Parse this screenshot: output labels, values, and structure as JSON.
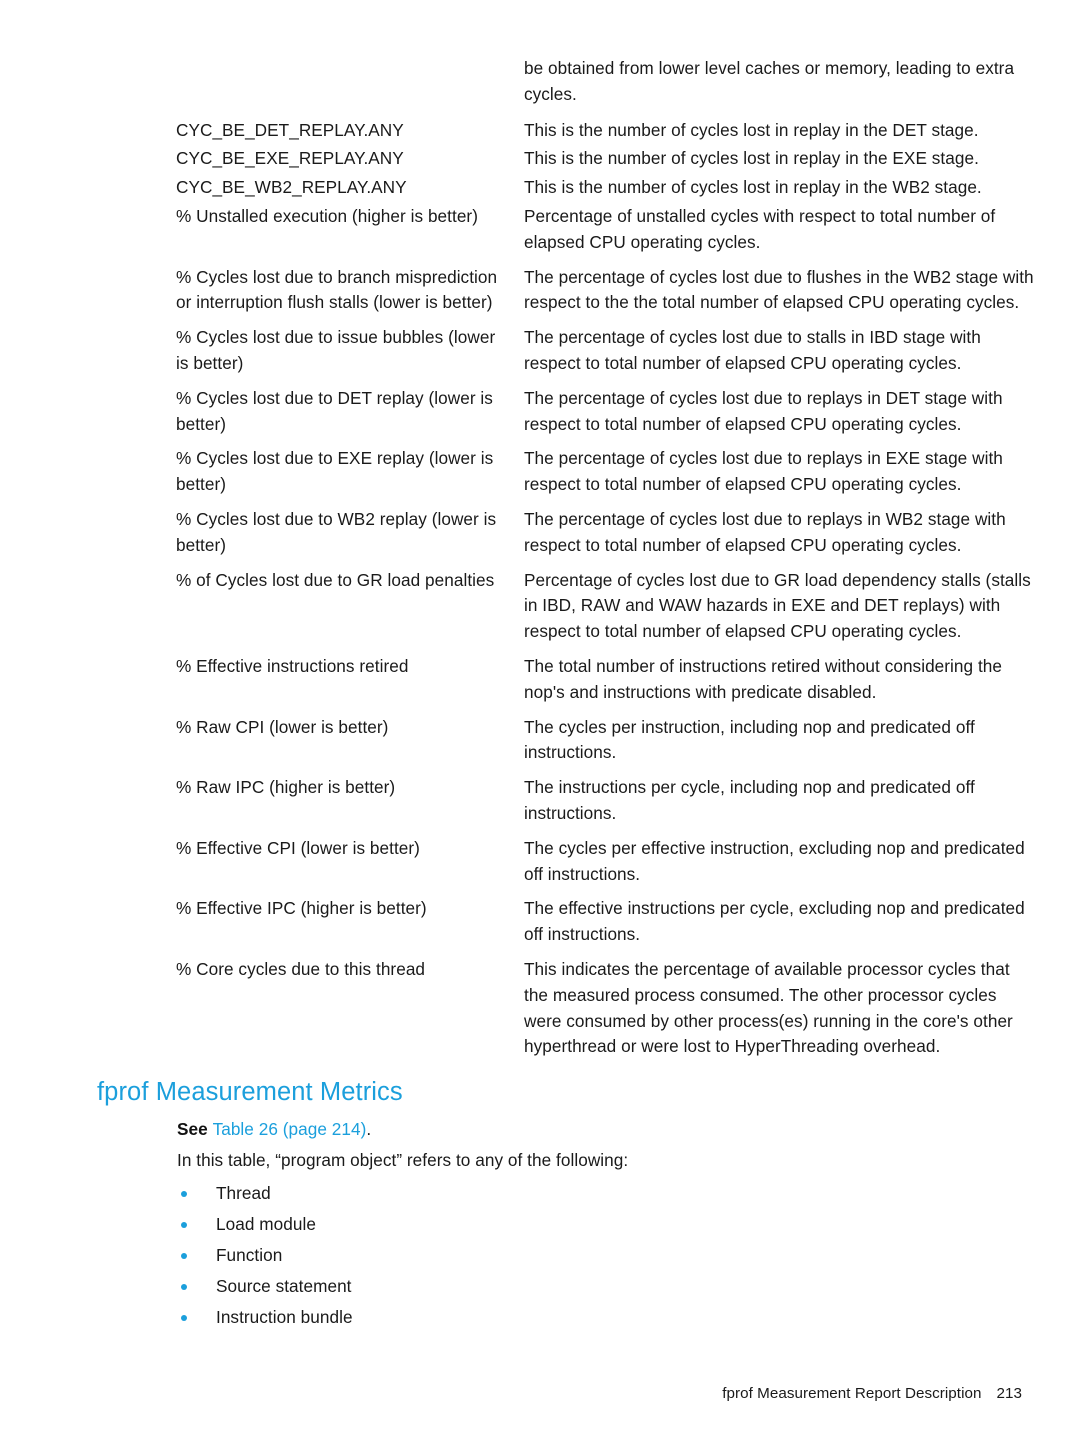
{
  "document": {
    "table_continuation": {
      "rows": [
        {
          "term": "",
          "description": "be obtained from lower level caches or memory, leading to extra cycles.",
          "continuation": true
        },
        {
          "term": "CYC_BE_DET_REPLAY.ANY",
          "description": "This is the number of cycles lost in replay in the DET stage.",
          "tight": true
        },
        {
          "term": "CYC_BE_EXE_REPLAY.ANY",
          "description": "This is the number of cycles lost in replay in the EXE stage.",
          "tight": true
        },
        {
          "term": "CYC_BE_WB2_REPLAY.ANY",
          "description": "This is the number of cycles lost in replay in the WB2 stage.",
          "tight": true
        },
        {
          "term": "% Unstalled execution (higher is better)",
          "description": "Percentage of unstalled cycles with respect to total number of elapsed CPU operating cycles."
        },
        {
          "term": "% Cycles lost due to branch misprediction or interruption flush stalls (lower is better)",
          "description": "The percentage of cycles lost due to flushes in the WB2 stage with respect to the the total number of elapsed CPU operating cycles."
        },
        {
          "term": "% Cycles lost due to issue bubbles (lower is better)",
          "description": "The percentage of cycles lost due to stalls in IBD stage with respect to total number of elapsed CPU operating cycles."
        },
        {
          "term": "% Cycles lost due to DET replay (lower is better)",
          "description": "The percentage of cycles lost due to replays in DET stage with respect to total number of elapsed CPU operating cycles."
        },
        {
          "term": "% Cycles lost due to EXE replay (lower is better)",
          "description": "The percentage of cycles lost due to replays in EXE stage with respect to total number of elapsed CPU operating cycles."
        },
        {
          "term": "% Cycles lost due to WB2 replay (lower is better)",
          "description": "The percentage of cycles lost due to replays in WB2 stage with respect to total number of elapsed CPU operating cycles."
        },
        {
          "term": "% of Cycles lost due to GR load penalties",
          "description": "Percentage of cycles lost due to GR load dependency stalls (stalls in IBD, RAW and WAW hazards in EXE and DET replays) with respect to total number of elapsed CPU operating cycles."
        },
        {
          "term": "% Effective instructions retired",
          "description": "The total number of instructions retired without considering the nop's and instructions with predicate disabled."
        },
        {
          "term": "% Raw CPI (lower is better)",
          "description": "The cycles per instruction, including nop and predicated off instructions."
        },
        {
          "term": "% Raw IPC (higher is better)",
          "description": "The instructions per cycle, including nop and predicated off instructions."
        },
        {
          "term": "% Effective CPI (lower is better)",
          "description": "The cycles per effective instruction, excluding nop and predicated off instructions."
        },
        {
          "term": "% Effective IPC (higher is better)",
          "description": "The effective instructions per cycle, excluding nop and predicated off instructions."
        },
        {
          "term": "% Core cycles due to this thread",
          "description": "This indicates the percentage of available processor cycles that the measured process consumed. The other processor cycles were consumed by other process(es) running in the core's other hyperthread or were lost to HyperThreading overhead."
        }
      ]
    },
    "section": {
      "heading": "fprof Measurement Metrics",
      "see_label": "See",
      "xref_text": "Table 26 (page 214)",
      "xref_suffix": ".",
      "intro": "In this table, “program object” refers to any of the following:",
      "bullets": [
        "Thread",
        "Load module",
        "Function",
        "Source statement",
        "Instruction bundle"
      ]
    },
    "footer": {
      "title": "fprof Measurement Report Description",
      "page_number": "213"
    },
    "colors": {
      "accent": "#1b9fdc",
      "body_text": "#1a1a1a",
      "background": "#ffffff"
    }
  }
}
